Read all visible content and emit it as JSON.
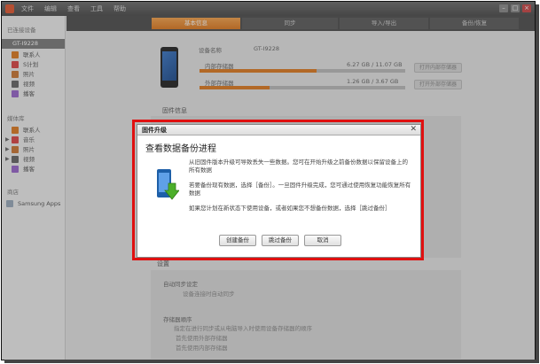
{
  "menu": [
    "文件",
    "编辑",
    "查看",
    "工具",
    "帮助"
  ],
  "sidebar": {
    "connected_label": "已连接设备",
    "device_name": "GT-I9228",
    "device_items": [
      "联系人",
      "S计划",
      "照片",
      "视频",
      "播客"
    ],
    "library_label": "媒体库",
    "library_items": [
      "联系人",
      "音乐",
      "照片",
      "视频",
      "播客"
    ],
    "store_label": "商店",
    "store_item": "Samsung Apps"
  },
  "tabs": [
    "基本信息",
    "同步",
    "导入/导出",
    "备份/恢复"
  ],
  "device_info": {
    "name_label": "设备名称",
    "name_value": "GT-I9228",
    "internal_label": "内部存储器",
    "internal_value": "6.27 GB / 11.07 GB",
    "internal_fraction": 0.57,
    "external_label": "外部存储器",
    "external_value": "1.26 GB / 3.67 GB",
    "external_fraction": 0.34,
    "open_internal_btn": "打开内部存储器",
    "open_external_btn": "打开外部存储器"
  },
  "firmware_section": "固件信息",
  "settings": {
    "section": "设置",
    "auto_sync_title": "自动同步设定",
    "auto_sync_value": "设备连接时自动同步",
    "storage_title": "存储器顺序",
    "storage_desc": "指定在进行同步或从电脑导入时使用设备存储器的顺序",
    "option1": "首先使用外部存储器",
    "option2": "首先使用内部存储器"
  },
  "dialog": {
    "title": "固件升级",
    "close_glyph": "✕",
    "heading": "查看数据备份进程",
    "para1": "从旧固件版本升级可导致丢失一些数据。您可在开始升级之前备份数据以保留设备上的所有数据",
    "para2": "若要备份现有数据，选择［备份］。一旦固件升级完成，您可通过使用恢复功能恢复所有数据",
    "para3": "如果您计划在新状态下使用设备，或者如果您不想备份数据，选择［跳过备份］",
    "btn_backup": "创建备份",
    "btn_skip": "跳过备份",
    "btn_cancel": "取消"
  },
  "colors": {
    "accent": "#e07a1f",
    "highlight_border": "#e01010"
  }
}
